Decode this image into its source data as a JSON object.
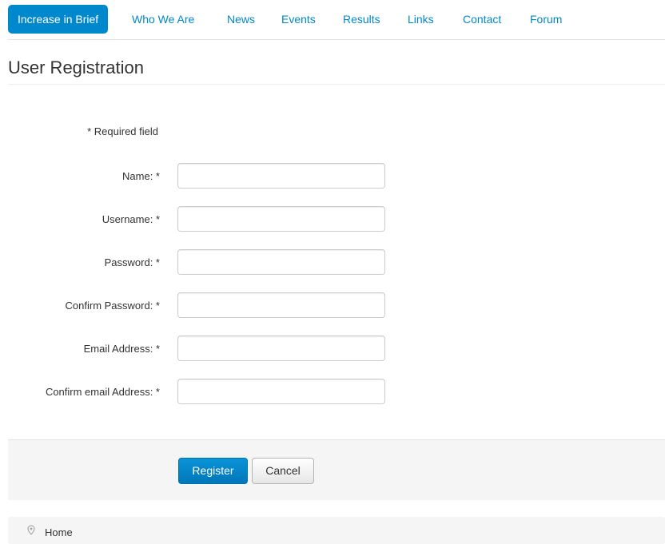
{
  "nav": {
    "items": [
      {
        "label": "Increase in Brief",
        "active": true
      },
      {
        "label": "Who We Are"
      },
      {
        "label": "News"
      },
      {
        "label": "Events"
      },
      {
        "label": "Results"
      },
      {
        "label": "Links"
      },
      {
        "label": "Contact"
      },
      {
        "label": "Forum"
      }
    ]
  },
  "page": {
    "title": "User Registration"
  },
  "form": {
    "required_note": "* Required field",
    "fields": [
      {
        "label": "Name: *",
        "value": ""
      },
      {
        "label": "Username: *",
        "value": ""
      },
      {
        "label": "Password: *",
        "value": ""
      },
      {
        "label": "Confirm Password: *",
        "value": ""
      },
      {
        "label": "Email Address: *",
        "value": ""
      },
      {
        "label": "Confirm email Address: *",
        "value": ""
      }
    ],
    "register_label": "Register",
    "cancel_label": "Cancel"
  },
  "breadcrumb": {
    "home_label": "Home",
    "icon": "map-marker-icon"
  },
  "colors": {
    "accent": "#0088cc",
    "panel": "#f5f5f5"
  }
}
